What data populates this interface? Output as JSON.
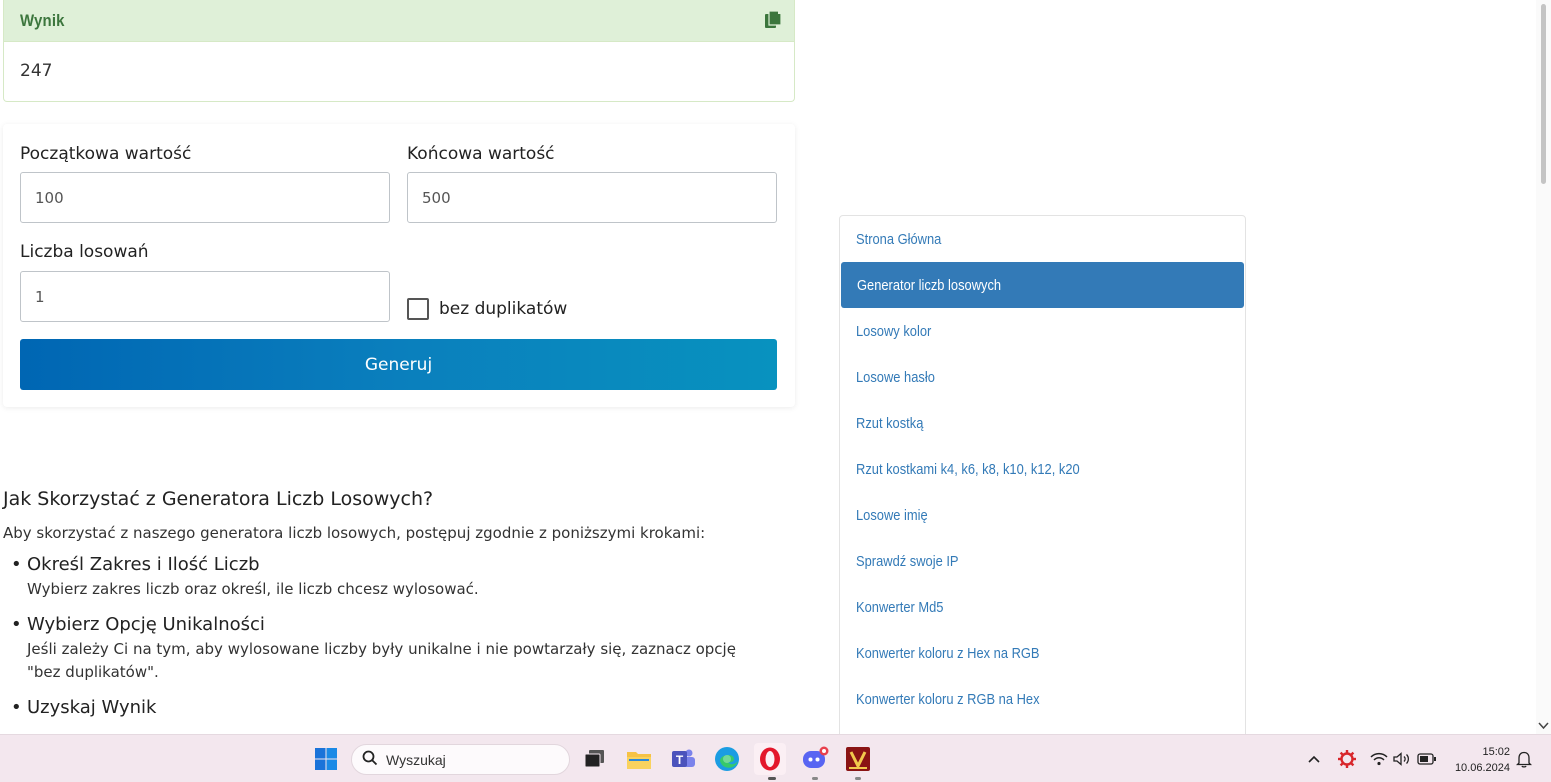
{
  "result": {
    "title": "Wynik",
    "value": "247"
  },
  "form": {
    "start_label": "Początkowa wartość",
    "start_value": "100",
    "end_label": "Końcowa wartość",
    "end_value": "500",
    "count_label": "Liczba losowań",
    "count_value": "1",
    "nodup_label": "bez duplikatów",
    "nodup_checked": false,
    "generate_label": "Generuj"
  },
  "article": {
    "title": "Jak Skorzystać z Generatora Liczb Losowych?",
    "intro": "Aby skorzystać z naszego generatora liczb losowych, postępuj zgodnie z poniższymi krokami:",
    "steps": [
      {
        "title": "Określ Zakres i Ilość Liczb",
        "desc": "Wybierz zakres liczb oraz określ, ile liczb chcesz wylosować."
      },
      {
        "title": "Wybierz Opcję Unikalności",
        "desc": "Jeśli zależy Ci na tym, aby wylosowane liczby były unikalne i nie powtarzały się, zaznacz opcję \"bez duplikatów\"."
      },
      {
        "title": "Uzyskaj Wynik",
        "desc": ""
      }
    ]
  },
  "nav": {
    "items": [
      {
        "label": "Strona Główna",
        "active": false
      },
      {
        "label": "Generator liczb losowych",
        "active": true
      },
      {
        "label": "Losowy kolor",
        "active": false
      },
      {
        "label": "Losowe hasło",
        "active": false
      },
      {
        "label": "Rzut kostką",
        "active": false
      },
      {
        "label": "Rzut kostkami k4, k6, k8, k10, k12, k20",
        "active": false
      },
      {
        "label": "Losowe imię",
        "active": false
      },
      {
        "label": "Sprawdź swoje IP",
        "active": false
      },
      {
        "label": "Konwerter Md5",
        "active": false
      },
      {
        "label": "Konwerter koloru z Hex na RGB",
        "active": false
      },
      {
        "label": "Konwerter koloru z RGB na Hex",
        "active": false
      }
    ]
  },
  "taskbar": {
    "search_placeholder": "Wyszukaj",
    "time": "15:02",
    "date": "10.06.2024",
    "icons": [
      "windows-start-icon",
      "task-view-icon",
      "file-explorer-icon",
      "teams-icon",
      "edge-icon",
      "opera-icon",
      "discord-icon",
      "app-icon"
    ]
  },
  "colors": {
    "accent": "#337ab7",
    "result_header_bg": "#dff0d8",
    "result_title": "#3c763d",
    "button_gradient_start": "#0066b3",
    "button_gradient_end": "#0892bf"
  }
}
